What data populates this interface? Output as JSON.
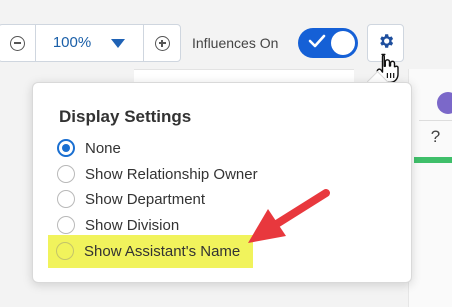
{
  "toolbar": {
    "zoom_value": "100%",
    "influences_label": "Influences On",
    "influences_on": true
  },
  "background": {
    "help_glyph": "?"
  },
  "display_settings": {
    "title": "Display Settings",
    "options": [
      {
        "label": "None",
        "checked": true
      },
      {
        "label": "Show Relationship Owner",
        "checked": false
      },
      {
        "label": "Show Department",
        "checked": false
      },
      {
        "label": "Show Division",
        "checked": false
      },
      {
        "label": "Show Assistant's Name",
        "checked": false,
        "highlighted": true
      }
    ]
  },
  "annotation": {
    "arrow_color": "#e8383d",
    "highlight_color": "#f1f35c"
  },
  "icons": {
    "zoom_out": "minus-circle-icon",
    "zoom_in": "plus-circle-icon",
    "dropdown": "caret-down-icon",
    "settings": "gear-icon",
    "pointer": "hand-pointer-icon",
    "toggle_check": "checkmark-icon"
  }
}
